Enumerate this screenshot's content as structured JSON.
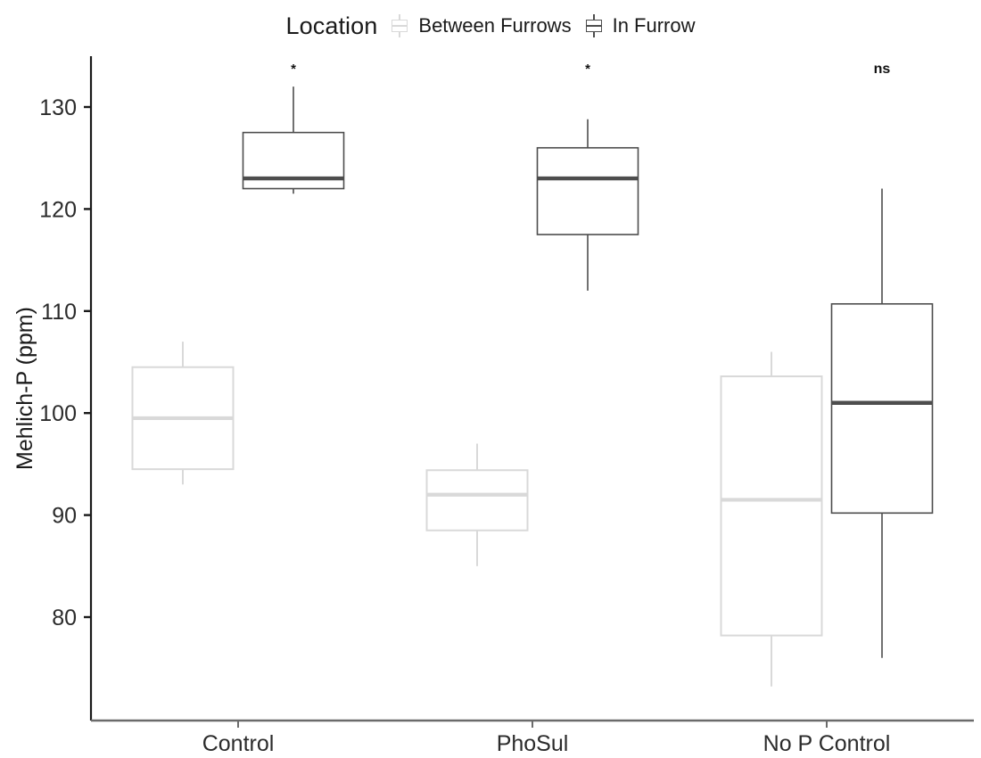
{
  "legend": {
    "title": "Location",
    "entries": [
      {
        "label": "Between Furrows",
        "color": "#d9d9d9",
        "key_icon": "boxplot-key-icon"
      },
      {
        "label": "In Furrow",
        "color": "#4d4d4d",
        "key_icon": "boxplot-key-icon"
      }
    ]
  },
  "chart_data": {
    "type": "boxplot",
    "title": "",
    "xlabel": "",
    "ylabel": "Mehlich-P (ppm)",
    "categories": [
      "Control",
      "PhoSul",
      "No P Control"
    ],
    "yticks": [
      80,
      90,
      100,
      110,
      120,
      130
    ],
    "ylim": [
      71,
      134
    ],
    "grid": false,
    "legend_position": "top",
    "group_key": "Location",
    "groups": [
      "Between Furrows",
      "In Furrow"
    ],
    "group_colors": {
      "Between Furrows": "#d9d9d9",
      "In Furrow": "#4d4d4d"
    },
    "annotations": [
      {
        "category": "Control",
        "text": "*",
        "y": 133.3
      },
      {
        "category": "PhoSul",
        "text": "*",
        "y": 133.3
      },
      {
        "category": "No P Control",
        "text": "ns",
        "y": 133.3
      }
    ],
    "series": [
      {
        "name": "Between Furrows",
        "color": "#d9d9d9",
        "boxes": [
          {
            "category": "Control",
            "whisker_low": 93.0,
            "q1": 94.5,
            "median": 99.5,
            "q3": 104.5,
            "whisker_high": 107.0
          },
          {
            "category": "PhoSul",
            "whisker_low": 85.0,
            "q1": 88.5,
            "median": 92.0,
            "q3": 94.4,
            "whisker_high": 97.0
          },
          {
            "category": "No P Control",
            "whisker_low": 73.2,
            "q1": 78.2,
            "median": 91.5,
            "q3": 103.6,
            "whisker_high": 106.0
          }
        ]
      },
      {
        "name": "In Furrow",
        "color": "#4d4d4d",
        "boxes": [
          {
            "category": "Control",
            "whisker_low": 121.5,
            "q1": 122.0,
            "median": 123.0,
            "q3": 127.5,
            "whisker_high": 132.0
          },
          {
            "category": "PhoSul",
            "whisker_low": 112.0,
            "q1": 117.5,
            "median": 123.0,
            "q3": 126.0,
            "whisker_high": 128.8
          },
          {
            "category": "No P Control",
            "whisker_low": 76.0,
            "q1": 90.2,
            "median": 101.0,
            "q3": 110.7,
            "whisker_high": 122.0
          }
        ]
      }
    ]
  },
  "axis": {
    "y_title": "Mehlich-P (ppm)",
    "y_tick_labels": [
      "130",
      "120",
      "110",
      "100",
      "90",
      "80"
    ],
    "x_tick_labels": [
      "Control",
      "PhoSul",
      "No P Control"
    ]
  }
}
